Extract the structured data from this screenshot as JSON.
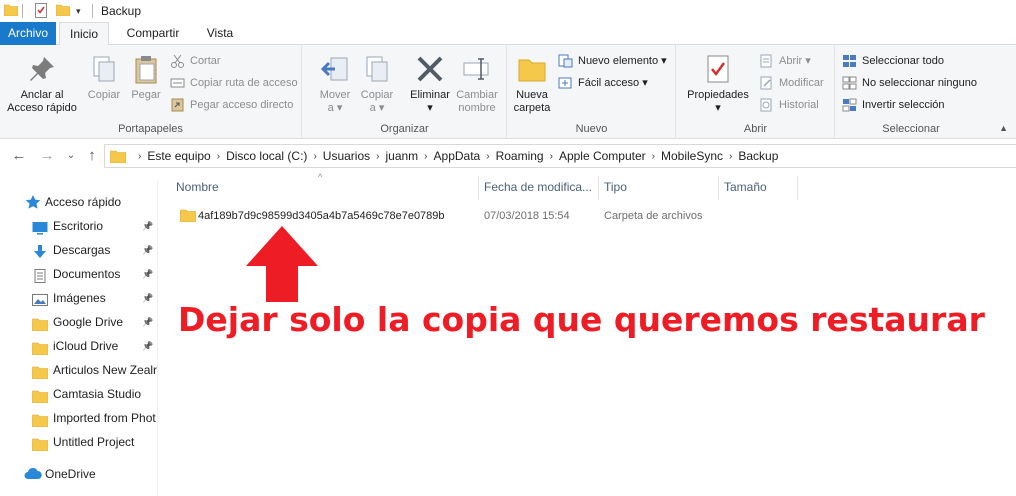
{
  "window": {
    "title": "Backup"
  },
  "tabs": {
    "archivo": "Archivo",
    "inicio": "Inicio",
    "compartir": "Compartir",
    "vista": "Vista"
  },
  "ribbon": {
    "portapapeles": {
      "label": "Portapapeles",
      "anclar": "Anclar al\nAcceso rápido",
      "anclar_l1": "Anclar al",
      "anclar_l2": "Acceso rápido",
      "copiar": "Copiar",
      "pegar": "Pegar",
      "cortar": "Cortar",
      "copiar_ruta": "Copiar ruta de acceso",
      "pegar_acceso": "Pegar acceso directo"
    },
    "organizar": {
      "label": "Organizar",
      "mover_l1": "Mover",
      "mover_l2": "a ▾",
      "copiar_l1": "Copiar",
      "copiar_l2": "a ▾",
      "eliminar_l1": "Eliminar",
      "eliminar_l2": "▾",
      "cambiar_l1": "Cambiar",
      "cambiar_l2": "nombre"
    },
    "nuevo": {
      "label": "Nuevo",
      "nueva_l1": "Nueva",
      "nueva_l2": "carpeta",
      "nuevo_elemento": "Nuevo elemento ▾",
      "facil_acceso": "Fácil acceso ▾"
    },
    "abrir": {
      "label": "Abrir",
      "propiedades_l1": "Propiedades",
      "propiedades_l2": "▾",
      "abrir": "Abrir ▾",
      "modificar": "Modificar",
      "historial": "Historial"
    },
    "seleccionar": {
      "label": "Seleccionar",
      "todo": "Seleccionar todo",
      "ninguno": "No seleccionar ninguno",
      "invertir": "Invertir selección"
    }
  },
  "address": {
    "crumbs": [
      "Este equipo",
      "Disco local (C:)",
      "Usuarios",
      "juanm",
      "AppData",
      "Roaming",
      "Apple Computer",
      "MobileSync",
      "Backup"
    ]
  },
  "navpane": {
    "quick_access": "Acceso rápido",
    "items": [
      {
        "label": "Escritorio",
        "pinned": true
      },
      {
        "label": "Descargas",
        "pinned": true
      },
      {
        "label": "Documentos",
        "pinned": true
      },
      {
        "label": "Imágenes",
        "pinned": true
      },
      {
        "label": "Google Drive",
        "pinned": true
      },
      {
        "label": "iCloud Drive",
        "pinned": true
      },
      {
        "label": "Articulos New Zealr",
        "pinned": false
      },
      {
        "label": "Camtasia Studio",
        "pinned": false
      },
      {
        "label": "Imported from Phot",
        "pinned": false
      },
      {
        "label": "Untitled Project",
        "pinned": false
      }
    ],
    "onedrive": "OneDrive"
  },
  "columns": {
    "nombre": "Nombre",
    "fecha": "Fecha de modifica...",
    "tipo": "Tipo",
    "tamano": "Tamaño"
  },
  "files": [
    {
      "name": "4af189b7d9c98599d3405a4b7a5469c78e7e0789b",
      "date": "07/03/2018 15:54",
      "type": "Carpeta de archivos",
      "size": ""
    }
  ],
  "annotation": {
    "text": "Dejar solo la copia que queremos restaurar",
    "color": "#ee1c24"
  },
  "colors": {
    "accent": "#1979ca",
    "folder": "#f5c84c",
    "header_text": "#4c607a"
  }
}
